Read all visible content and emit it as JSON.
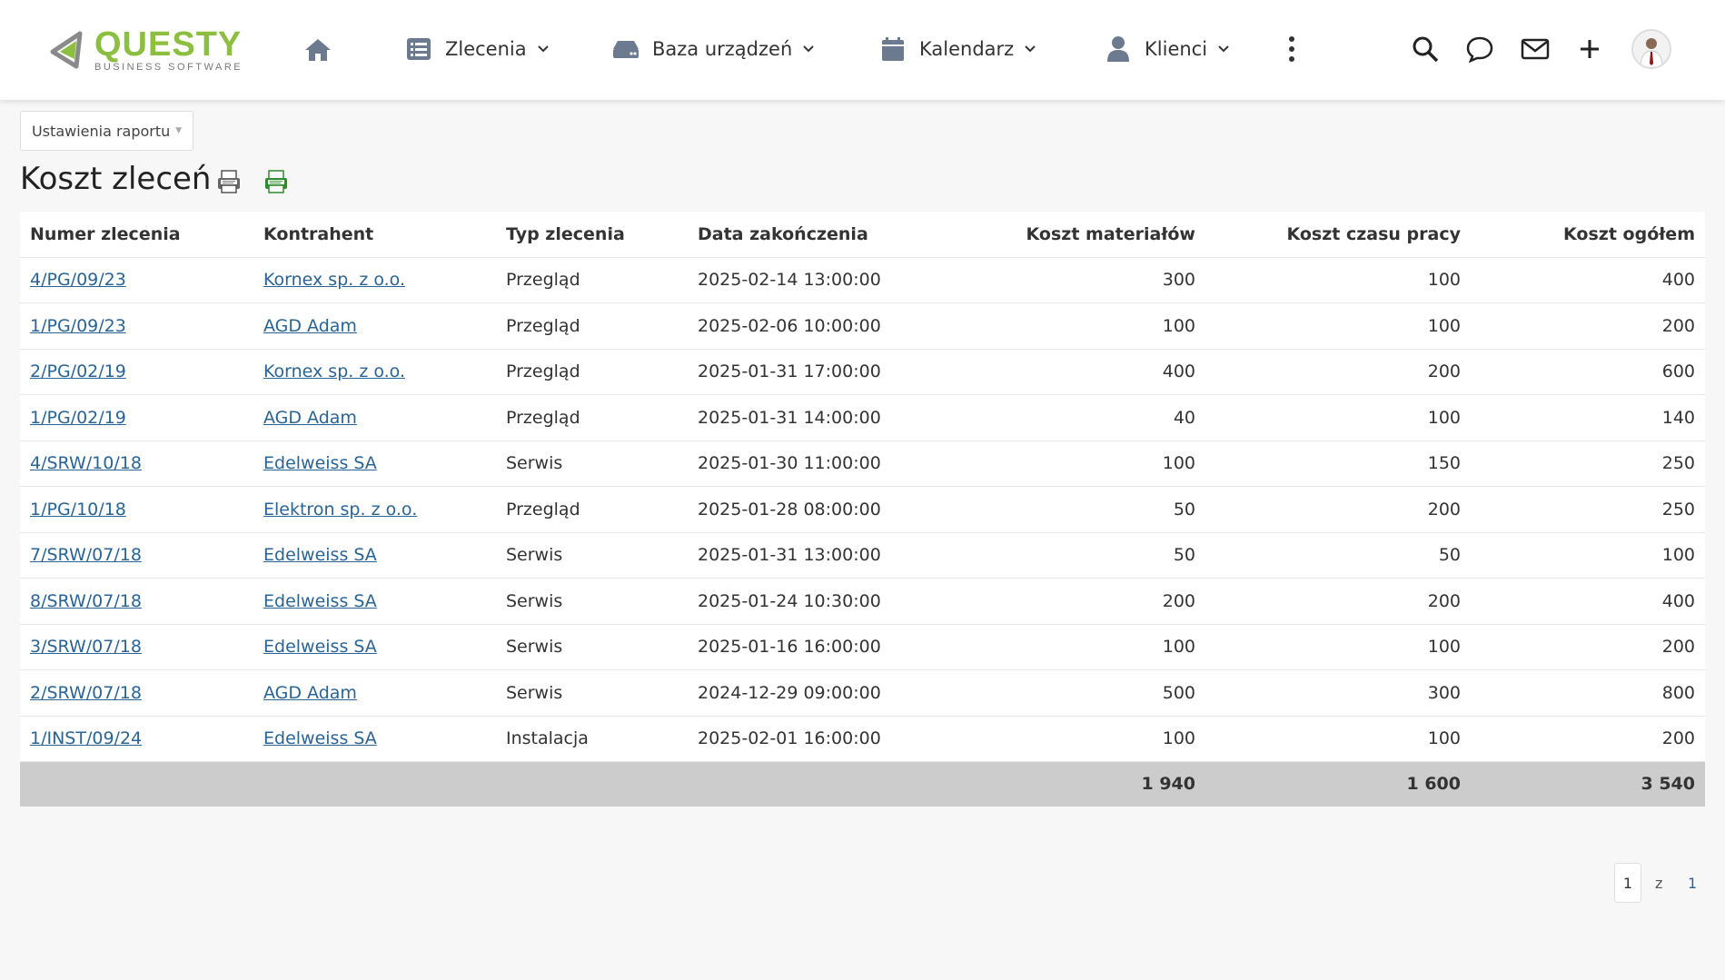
{
  "brand": {
    "name": "QUESTY",
    "tagline": "BUSINESS SOFTWARE",
    "accent": "#8cbf3f"
  },
  "nav": {
    "home_icon": "home-icon",
    "items": [
      {
        "label": "Zlecenia",
        "icon": "list-icon"
      },
      {
        "label": "Baza urządzeń",
        "icon": "device-icon"
      },
      {
        "label": "Kalendarz",
        "icon": "calendar-icon"
      },
      {
        "label": "Klienci",
        "icon": "user-icon"
      }
    ],
    "more_icon": "more-vertical-icon"
  },
  "header_actions": [
    "search-icon",
    "chat-icon",
    "mail-icon",
    "plus-icon",
    "avatar"
  ],
  "report": {
    "settings_label": "Ustawienia raportu",
    "title": "Koszt zleceń",
    "export_icons": [
      "csv-icon",
      "xlsx-icon"
    ]
  },
  "table": {
    "columns": [
      "Numer zlecenia",
      "Kontrahent",
      "Typ zlecenia",
      "Data zakończenia",
      "Koszt materiałów",
      "Koszt czasu pracy",
      "Koszt ogółem"
    ],
    "rows": [
      [
        "4/PG/09/23",
        "Kornex sp. z o.o.",
        "Przegląd",
        "2025-02-14 13:00:00",
        "300",
        "100",
        "400"
      ],
      [
        "1/PG/09/23",
        "AGD Adam",
        "Przegląd",
        "2025-02-06 10:00:00",
        "100",
        "100",
        "200"
      ],
      [
        "2/PG/02/19",
        "Kornex sp. z o.o.",
        "Przegląd",
        "2025-01-31 17:00:00",
        "400",
        "200",
        "600"
      ],
      [
        "1/PG/02/19",
        "AGD Adam",
        "Przegląd",
        "2025-01-31 14:00:00",
        "40",
        "100",
        "140"
      ],
      [
        "4/SRW/10/18",
        "Edelweiss SA",
        "Serwis",
        "2025-01-30 11:00:00",
        "100",
        "150",
        "250"
      ],
      [
        "1/PG/10/18",
        "Elektron sp. z o.o.",
        "Przegląd",
        "2025-01-28 08:00:00",
        "50",
        "200",
        "250"
      ],
      [
        "7/SRW/07/18",
        "Edelweiss SA",
        "Serwis",
        "2025-01-31 13:00:00",
        "50",
        "50",
        "100"
      ],
      [
        "8/SRW/07/18",
        "Edelweiss SA",
        "Serwis",
        "2025-01-24 10:30:00",
        "200",
        "200",
        "400"
      ],
      [
        "3/SRW/07/18",
        "Edelweiss SA",
        "Serwis",
        "2025-01-16 16:00:00",
        "100",
        "100",
        "200"
      ],
      [
        "2/SRW/07/18",
        "AGD Adam",
        "Serwis",
        "2024-12-29 09:00:00",
        "500",
        "300",
        "800"
      ],
      [
        "1/INST/09/24",
        "Edelweiss SA",
        "Instalacja",
        "2025-02-01 16:00:00",
        "100",
        "100",
        "200"
      ]
    ],
    "totals": [
      "",
      "",
      "",
      "",
      "1 940",
      "1 600",
      "3 540"
    ]
  },
  "pagination": {
    "current": "1",
    "separator": "z",
    "total": "1"
  },
  "colors": {
    "link": "#2a6496",
    "total_row_bg": "#cccccc"
  }
}
